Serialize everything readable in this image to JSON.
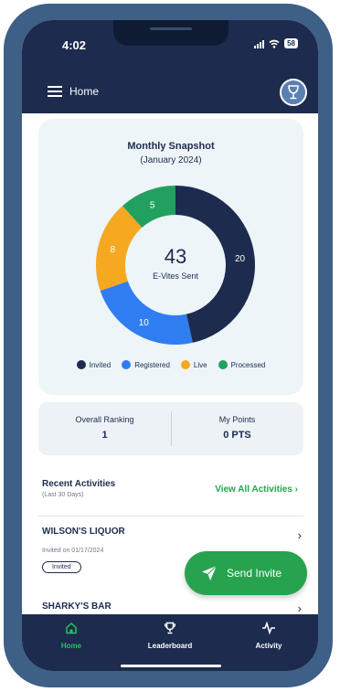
{
  "status": {
    "time": "4:02",
    "battery": "58"
  },
  "header": {
    "title": "Home"
  },
  "snapshot": {
    "title": "Monthly Snapshot",
    "subtitle": "(January 2024)",
    "center_value": "43",
    "center_label": "E-Vites Sent"
  },
  "chart_data": {
    "type": "pie",
    "categories": [
      "Invited",
      "Registered",
      "Live",
      "Processed"
    ],
    "values": [
      20,
      10,
      8,
      5
    ],
    "colors": [
      "#1c2b4e",
      "#2f7df0",
      "#f6a821",
      "#22a060"
    ]
  },
  "legend": [
    {
      "label": "Invited",
      "color": "#1c2b4e"
    },
    {
      "label": "Registered",
      "color": "#2f7df0"
    },
    {
      "label": "Live",
      "color": "#f6a821"
    },
    {
      "label": "Processed",
      "color": "#22a060"
    }
  ],
  "stats": {
    "ranking_label": "Overall Ranking",
    "ranking_value": "1",
    "points_label": "My Points",
    "points_value": "0 PTS"
  },
  "recent": {
    "title": "Recent Activities",
    "subtitle": "(Last 30 Days)",
    "view_all": "View All Activities",
    "items": [
      {
        "name": "WILSON'S LIQUOR",
        "date": "Invited on 01/17/2024",
        "status": "Invited"
      },
      {
        "name": "SHARKY'S BAR"
      }
    ]
  },
  "fab": {
    "label": "Send Invite"
  },
  "tabs": [
    {
      "label": "Home"
    },
    {
      "label": "Leaderboard"
    },
    {
      "label": "Activity"
    }
  ],
  "colors": {
    "navy": "#1c2b4e",
    "green": "#27a34f",
    "frame": "#3e5f86"
  }
}
